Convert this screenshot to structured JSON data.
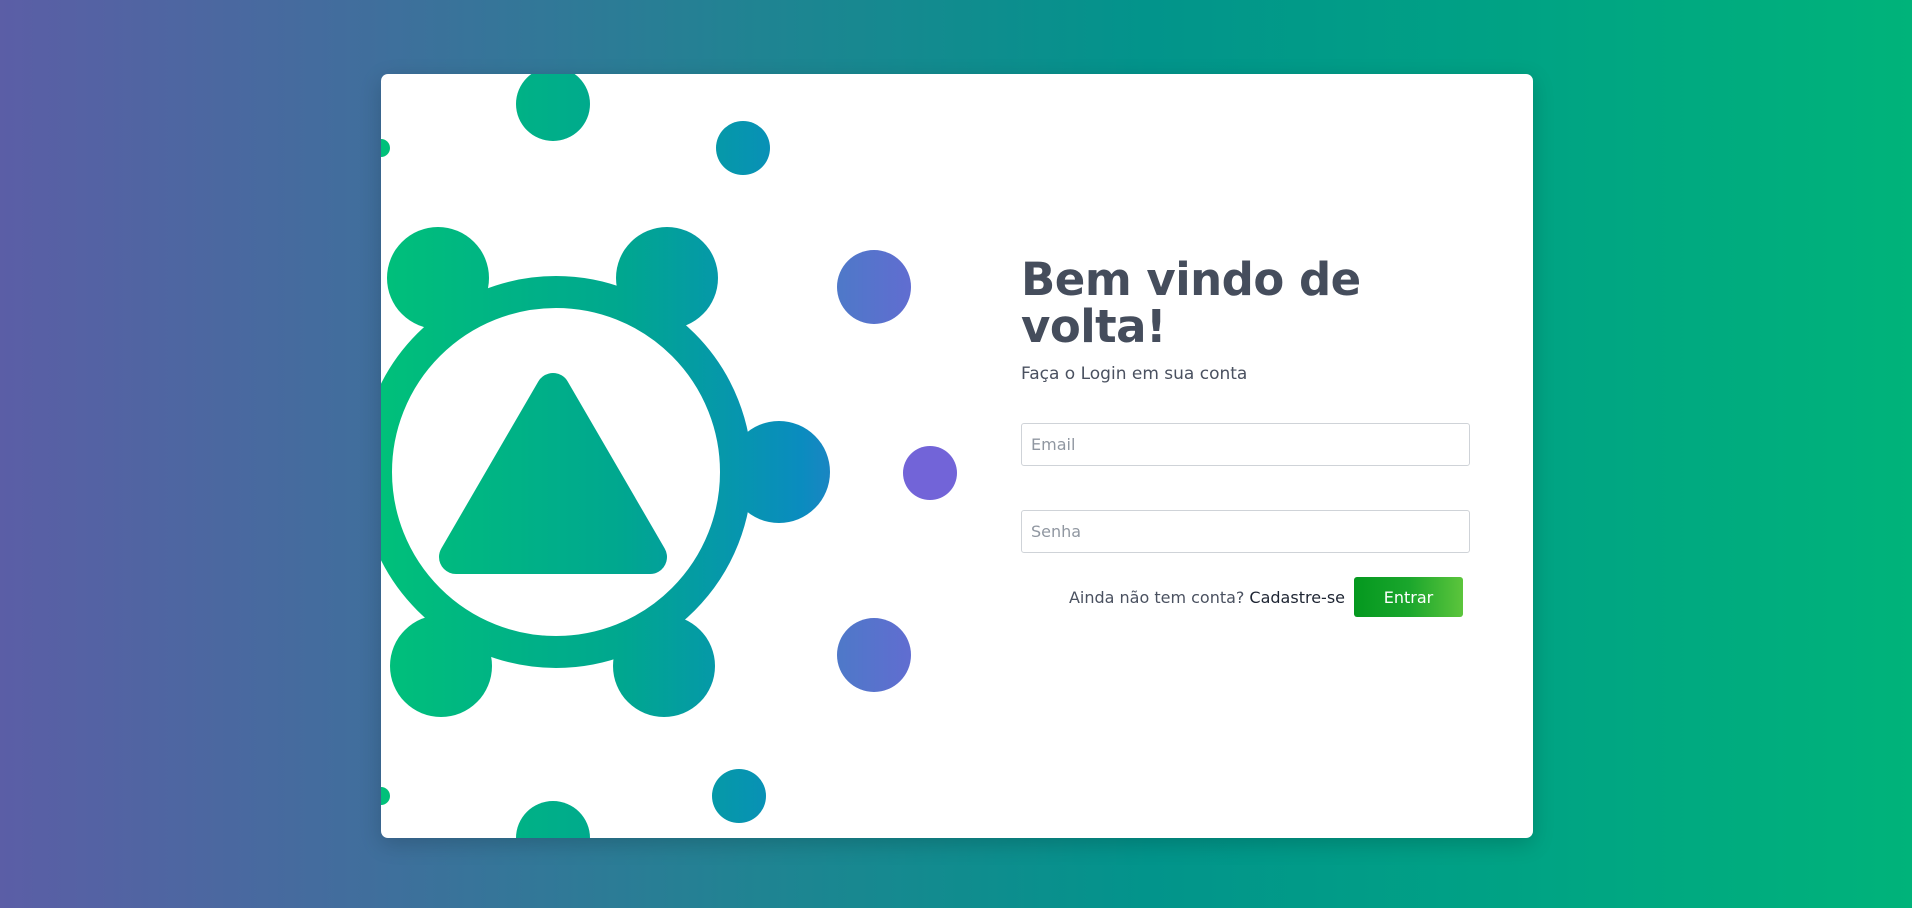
{
  "login": {
    "title": "Bem vindo de volta!",
    "subtitle": "Faça o Login em sua conta",
    "email_placeholder": "Email",
    "password_placeholder": "Senha",
    "signup_prompt": "Ainda não tem conta?",
    "signup_link": "Cadastre-se",
    "submit_label": "Entrar"
  },
  "illustration": {
    "icon": "network-triangle-logo",
    "colors": {
      "green": "#00c07a",
      "teal": "#0097a7",
      "blue": "#3c86c4",
      "purple": "#6f66d6"
    }
  },
  "theme": {
    "background_start": "#5b5ea6",
    "background_end": "#00b37a",
    "button_start": "#04981f",
    "button_end": "#5cc53c",
    "text_color": "#454d5c"
  }
}
